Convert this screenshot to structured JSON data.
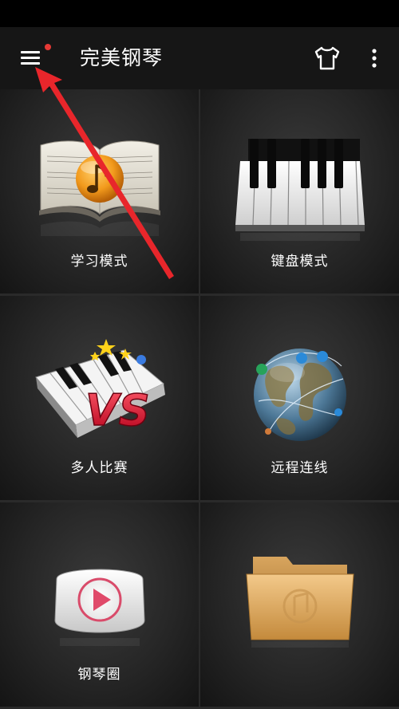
{
  "app": {
    "title": "完美钢琴"
  },
  "header": {
    "menu_icon": "hamburger-menu-icon",
    "skin_icon": "tshirt-icon",
    "more_icon": "more-vertical-icon",
    "notification_dot_color": "#e53935"
  },
  "tiles": [
    {
      "label": "学习模式",
      "icon": "music-book-icon"
    },
    {
      "label": "键盘模式",
      "icon": "piano-keys-icon"
    },
    {
      "label": "多人比赛",
      "icon": "vs-piano-icon"
    },
    {
      "label": "远程连线",
      "icon": "globe-network-icon"
    },
    {
      "label": "钢琴圈",
      "icon": "video-play-icon"
    },
    {
      "label": "",
      "icon": "music-folder-icon"
    }
  ],
  "annotation": {
    "arrow_color": "#e8262b"
  }
}
